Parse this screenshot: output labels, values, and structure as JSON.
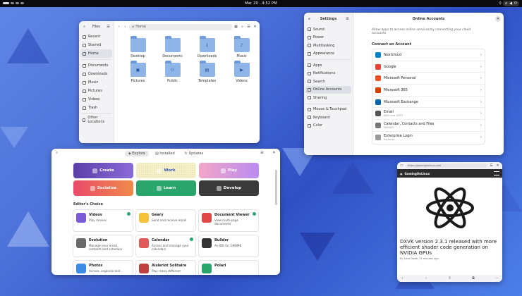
{
  "topbar": {
    "clock": "Mar 20  ·  4:52 PM"
  },
  "files": {
    "title": "Files",
    "path": "Home",
    "sidebar": [
      "Recent",
      "Starred",
      "Home",
      "Documents",
      "Downloads",
      "Music",
      "Pictures",
      "Videos",
      "Trash"
    ],
    "other_locations": "Other Locations",
    "folders": [
      {
        "name": "Desktop",
        "glyph": ""
      },
      {
        "name": "Documents",
        "glyph": ""
      },
      {
        "name": "Downloads",
        "glyph": "⤓"
      },
      {
        "name": "Music",
        "glyph": "♪"
      },
      {
        "name": "Pictures",
        "glyph": "▣"
      },
      {
        "name": "Public",
        "glyph": "⚇"
      },
      {
        "name": "Templates",
        "glyph": "▤"
      },
      {
        "name": "Videos",
        "glyph": "▶"
      }
    ]
  },
  "settings": {
    "title": "Settings",
    "panel_title": "Online Accounts",
    "description": "Allow apps to access online services by connecting your cloud accounts",
    "section": "Connect an Account",
    "nav": [
      "Sound",
      "Power",
      "Multitasking",
      "Appearance",
      "Apps",
      "Notifications",
      "Search",
      "Online Accounts",
      "Sharing",
      "Mouse & Touchpad",
      "Keyboard",
      "Color"
    ],
    "accounts": [
      {
        "name": "Nextcloud",
        "sub": "",
        "color": "#0082c9"
      },
      {
        "name": "Google",
        "sub": "",
        "color": "#ea4335"
      },
      {
        "name": "Microsoft Personal",
        "sub": "",
        "color": "#f25022"
      },
      {
        "name": "Microsoft 365",
        "sub": "",
        "color": "#d83b01"
      },
      {
        "name": "Microsoft Exchange",
        "sub": "",
        "color": "#0a64ad"
      },
      {
        "name": "Email",
        "sub": "IMAP and SMTP",
        "color": "#555555"
      },
      {
        "name": "Calendar, Contacts and Files",
        "sub": "WebDAV",
        "color": "#777777"
      },
      {
        "name": "Enterprise Login",
        "sub": "Kerberos",
        "color": "#999999"
      }
    ]
  },
  "software": {
    "tabs": [
      "Explore",
      "Installed",
      "Updates"
    ],
    "categories": [
      {
        "label": "Create",
        "bg": "linear-gradient(90deg,#5b3fa8,#8a6ad8)",
        "fg": "#ffffff"
      },
      {
        "label": "Work",
        "bg": "#f6f0c8",
        "fg": "#3b56b8"
      },
      {
        "label": "Play",
        "bg": "linear-gradient(90deg,#f2a6c6,#b98bf0)",
        "fg": "#ffffff"
      },
      {
        "label": "Socialize",
        "bg": "linear-gradient(90deg,#ea4a6a,#f08a4a)",
        "fg": "#ffffff"
      },
      {
        "label": "Learn",
        "bg": "#2aa56b",
        "fg": "#ffffff"
      },
      {
        "label": "Develop",
        "bg": "#3a3a3a",
        "fg": "#ffffff"
      }
    ],
    "editors_choice": "Editor's Choice",
    "apps": [
      {
        "name": "Videos",
        "desc": "Play movies",
        "color": "#7b5cd6",
        "installed": true
      },
      {
        "name": "Geary",
        "desc": "Send and receive email",
        "color": "#f5c23a",
        "installed": false
      },
      {
        "name": "Document Viewer",
        "desc": "View multi-page documents",
        "color": "#e04848",
        "installed": true
      },
      {
        "name": "Evolution",
        "desc": "Manage your email, contacts and schedule",
        "color": "#6a6a6a",
        "installed": false
      },
      {
        "name": "Calendar",
        "desc": "Access and manage your calendars",
        "color": "#e05a5a",
        "installed": true
      },
      {
        "name": "Builder",
        "desc": "An IDE for GNOME",
        "color": "#333333",
        "installed": false
      },
      {
        "name": "Photos",
        "desc": "Access, organize and",
        "color": "#3d8ce6",
        "installed": false
      },
      {
        "name": "Aisleriot Solitaire",
        "desc": "Play many different",
        "color": "#c04040",
        "installed": false
      },
      {
        "name": "Polari",
        "desc": "",
        "color": "#2aa56b",
        "installed": false
      }
    ]
  },
  "browser": {
    "url": "https://gamingonlinux.com",
    "site_name": "GamingOnLinux",
    "headline": "DXVK version 2.3.1 released with more efficient shader code generation on NVIDIA GPUs",
    "meta": "By Liam Dawe, 21 minutes ago",
    "bottom": [
      "‹",
      "›",
      "⇧",
      "⧉",
      "⋯"
    ]
  }
}
